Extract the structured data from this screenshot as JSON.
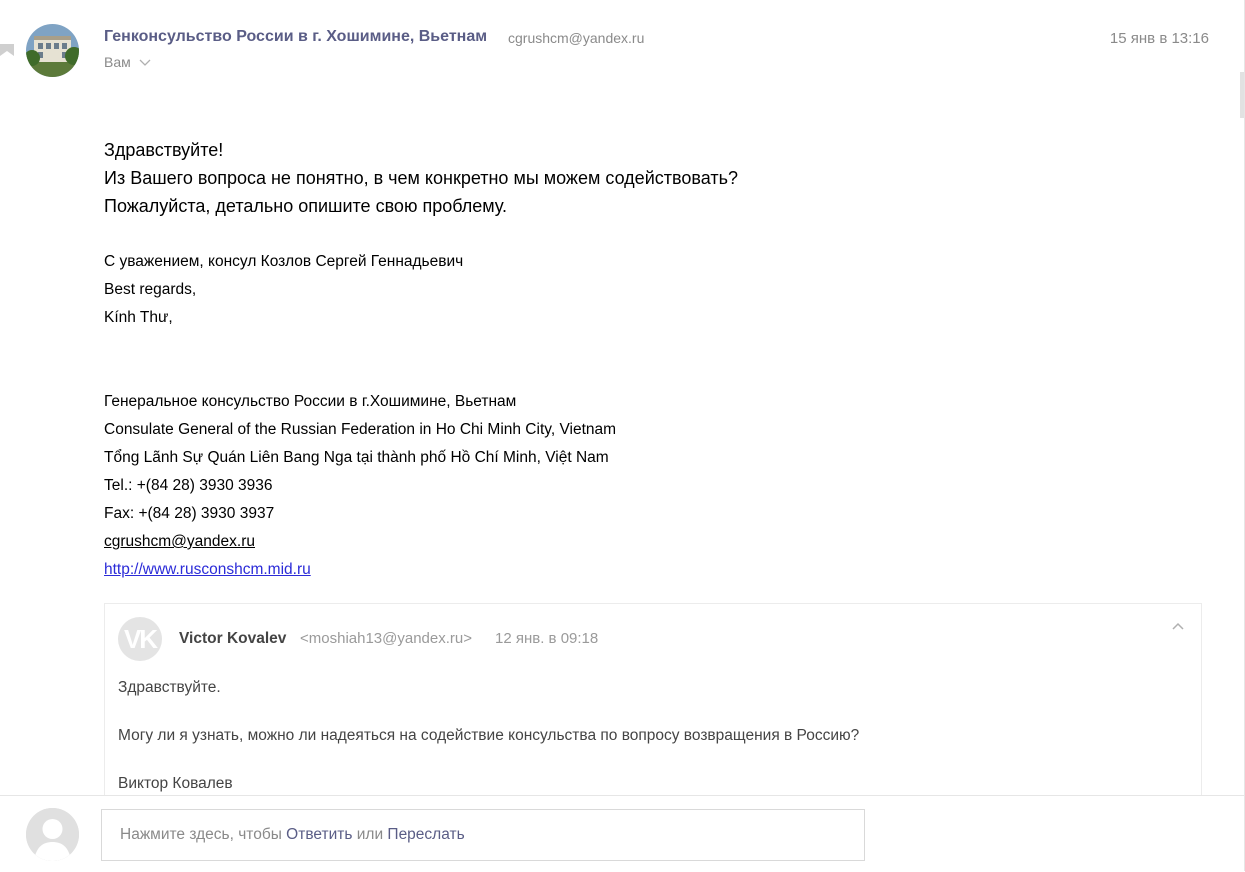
{
  "message": {
    "sender_name": "Генконсульство России в г. Хошимине, Вьетнам",
    "sender_email": "cgrushcm@yandex.ru",
    "to_label": "Вам",
    "date": "15 янв в 13:16",
    "body_lines": [
      "Здравствуйте!",
      "Из Вашего вопроса не понятно, в чем конкретно мы можем содействовать?",
      "Пожалуйста, детально опишите свою проблему."
    ],
    "signature_lines": [
      "С уважением, консул Козлов Сергей Геннадьевич",
      "Best regards,",
      "Kính Thư,"
    ],
    "contact": {
      "org_ru": "Генеральное консульство России в г.Хошимине, Вьетнам",
      "org_en": "Consulate General of the Russian Federation in Ho Chi Minh City, Vietnam",
      "org_vi": "Tổng Lãnh Sự Quán Liên Bang Nga tại thành phố Hồ Chí Minh, Việt Nam",
      "tel": "Tel.: +(84 28) 3930 3936",
      "fax": "Fax: +(84 28) 3930 3937",
      "email": "cgrushcm@yandex.ru",
      "website": "http://www.rusconshcm.mid.ru"
    }
  },
  "quoted": {
    "initials": "VK",
    "name": "Victor Kovalev",
    "email": "<moshiah13@yandex.ru>",
    "date": "12 янв. в 09:18",
    "lines": [
      "Здравствуйте.",
      "Могу ли я узнать, можно ли надеяться на содействие консульства по вопросу возвращения в Россию?",
      "Виктор Ковалев"
    ]
  },
  "reply": {
    "prefix": "Нажмите здесь, чтобы ",
    "reply_label": "Ответить",
    "middle": " или ",
    "forward_label": "Переслать"
  },
  "colors": {
    "sender_name": "#5a5d86",
    "muted": "#8a8a8a",
    "link": "#2b2bd8"
  },
  "icons": [
    "back-arrow-icon",
    "chevron-down-icon",
    "chevron-up-icon",
    "user-silhouette-icon"
  ]
}
